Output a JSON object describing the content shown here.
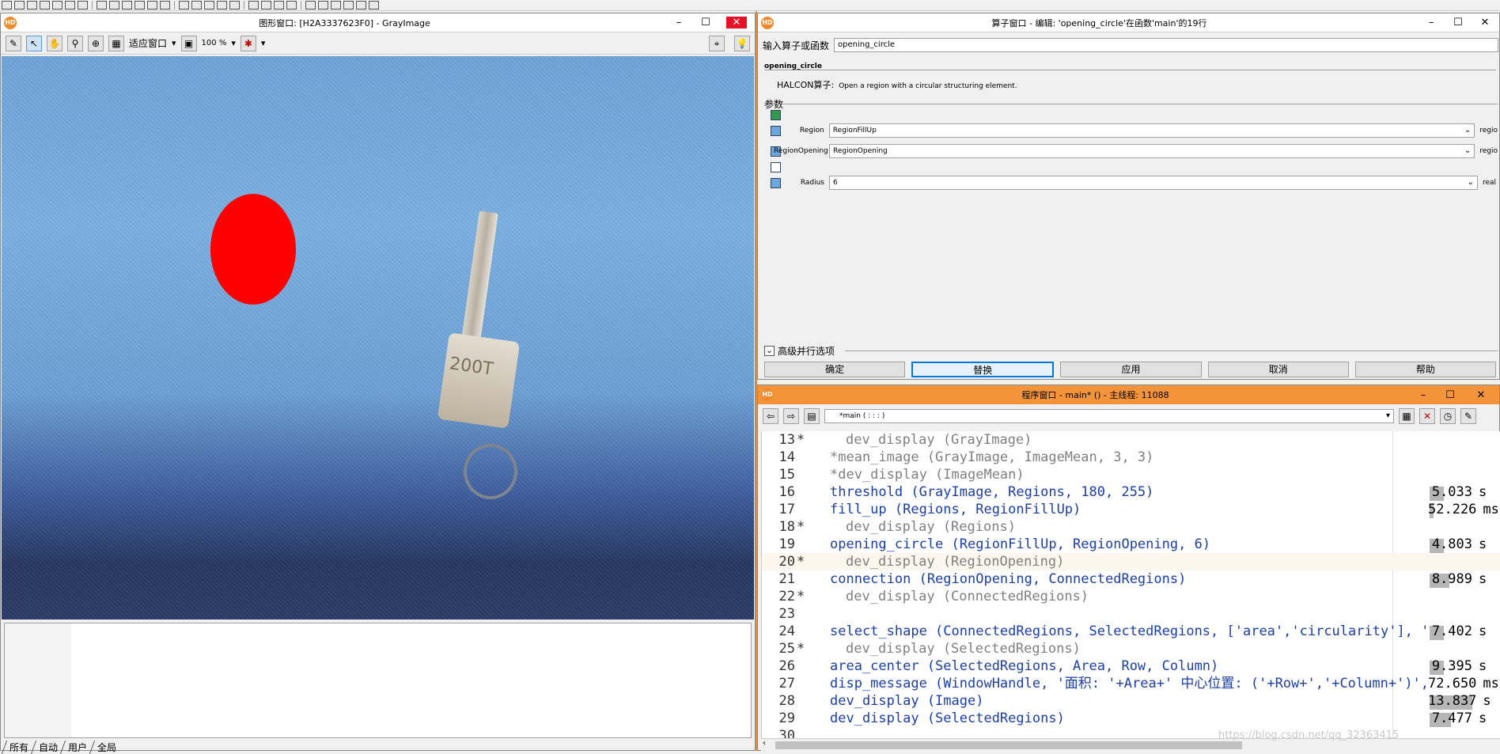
{
  "graphics_window": {
    "title": "图形窗口: [H2A3337623F0] - GrayImage",
    "toolbar": {
      "fit_window": "适应窗口",
      "zoom": "100 %"
    },
    "tabs": [
      "所有",
      "自动",
      "用户",
      "全局"
    ],
    "image_text": "200T"
  },
  "operator_window": {
    "title": "算子窗口 - 编辑: 'opening_circle'在函数'main'的19行",
    "input_label": "输入算子或函数",
    "input_value": "opening_circle",
    "op_name": "opening_circle",
    "op_kind": "HALCON算子:",
    "op_desc": "Open a region with a circular structuring element.",
    "params_label": "参数",
    "params": [
      {
        "label": "Region",
        "value": "RegionFillUp",
        "type": "regio"
      },
      {
        "label": "RegionOpening",
        "value": "RegionOpening",
        "type": "regio"
      },
      {
        "label": "Radius",
        "value": "6",
        "type": "real"
      }
    ],
    "advanced_label": "高级并行选项",
    "buttons": {
      "ok": "确定",
      "replace": "替换",
      "apply": "应用",
      "cancel": "取消",
      "help": "帮助"
    }
  },
  "program_window": {
    "title": "程序窗口 - main* () - 主线程: 11088",
    "procedure": "*main ( : : : )",
    "lines": [
      {
        "num": "13",
        "mark": "*",
        "text": "dev_display (GrayImage)",
        "disabled": true,
        "time": "",
        "unit": ""
      },
      {
        "num": "14",
        "mark": "",
        "text": "*mean_image (GrayImage, ImageMean, 3, 3)",
        "disabled": true,
        "time": "",
        "unit": ""
      },
      {
        "num": "15",
        "mark": "",
        "text": "*dev_display (ImageMean)",
        "disabled": true,
        "time": "",
        "unit": ""
      },
      {
        "num": "16",
        "mark": "",
        "text": "threshold (GrayImage, Regions, 180, 255)",
        "disabled": false,
        "time": "5.033",
        "unit": "s"
      },
      {
        "num": "17",
        "mark": "",
        "text": "fill_up (Regions, RegionFillUp)",
        "disabled": false,
        "time": "52.226",
        "unit": "ms"
      },
      {
        "num": "18",
        "mark": "*",
        "text": "dev_display (Regions)",
        "disabled": true,
        "time": "",
        "unit": ""
      },
      {
        "num": "19",
        "mark": "",
        "text": "opening_circle (RegionFillUp, RegionOpening, 6)",
        "disabled": false,
        "time": "4.803",
        "unit": "s"
      },
      {
        "num": "20",
        "mark": "*",
        "text": "dev_display (RegionOpening)",
        "disabled": true,
        "time": "",
        "unit": ""
      },
      {
        "num": "21",
        "mark": "",
        "text": "connection (RegionOpening, ConnectedRegions)",
        "disabled": false,
        "time": "8.989",
        "unit": "s"
      },
      {
        "num": "22",
        "mark": "*",
        "text": "dev_display (ConnectedRegions)",
        "disabled": true,
        "time": "",
        "unit": ""
      },
      {
        "num": "23",
        "mark": "",
        "text": "",
        "disabled": false,
        "time": "",
        "unit": ""
      },
      {
        "num": "24",
        "mark": "",
        "text": "select_shape (ConnectedRegions, SelectedRegions, ['area','circularity'], 'a",
        "disabled": false,
        "time": "7.402",
        "unit": "s"
      },
      {
        "num": "25",
        "mark": "*",
        "text": "dev_display (SelectedRegions)",
        "disabled": true,
        "time": "",
        "unit": ""
      },
      {
        "num": "26",
        "mark": "",
        "text": "area_center (SelectedRegions, Area, Row, Column)",
        "disabled": false,
        "time": "9.395",
        "unit": "s"
      },
      {
        "num": "27",
        "mark": "",
        "text": "disp_message (WindowHandle, '面积: '+Area+' 中心位置: ('+Row+','+Column+')',",
        "disabled": false,
        "time": "72.650",
        "unit": "ms"
      },
      {
        "num": "28",
        "mark": "",
        "text": "dev_display (Image)",
        "disabled": false,
        "time": "13.837",
        "unit": "s"
      },
      {
        "num": "29",
        "mark": "",
        "text": "dev_display (SelectedRegions)",
        "disabled": false,
        "time": "7.477",
        "unit": "s"
      },
      {
        "num": "30",
        "mark": "",
        "text": "",
        "disabled": false,
        "time": "",
        "unit": ""
      }
    ],
    "timing_fill": [
      0.2,
      0,
      0,
      0.2,
      0.05,
      0,
      0.2,
      0,
      0.28,
      0,
      0,
      0.2,
      0,
      0.2,
      0,
      0.6,
      0.3,
      0
    ],
    "watermark": "https://blog.csdn.net/qq_32363415"
  },
  "colors": {
    "accent_orange": "#f4943a",
    "code_blue": "#1b3fa6",
    "region_red": "#ff0000"
  }
}
